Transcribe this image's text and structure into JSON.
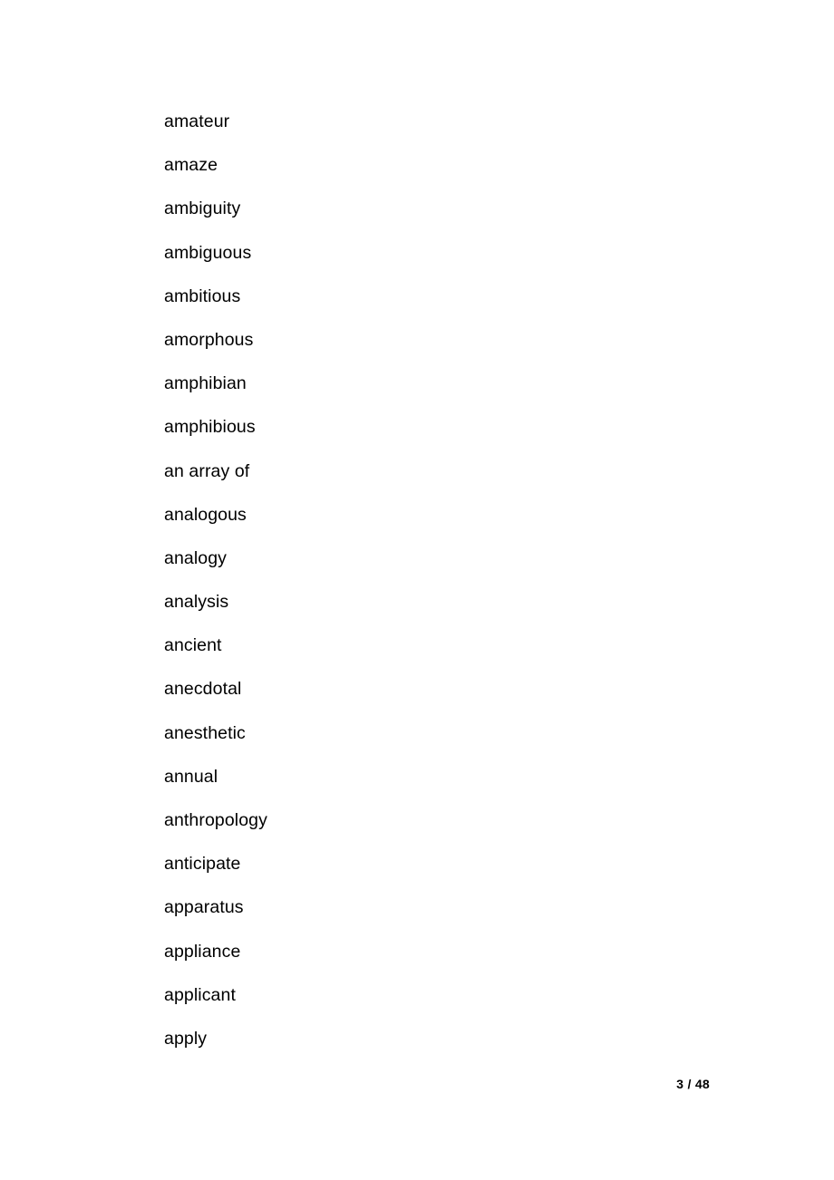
{
  "document": {
    "background_color": "#ffffff",
    "text_color": "#000000",
    "word_list": [
      {
        "term": "amateur"
      },
      {
        "term": "amaze"
      },
      {
        "term": "ambiguity"
      },
      {
        "term": "ambiguous"
      },
      {
        "term": "ambitious"
      },
      {
        "term": "amorphous"
      },
      {
        "term": "amphibian"
      },
      {
        "term": "amphibious"
      },
      {
        "term": "an array of"
      },
      {
        "term": "analogous"
      },
      {
        "term": "analogy"
      },
      {
        "term": "analysis"
      },
      {
        "term": "ancient"
      },
      {
        "term": "anecdotal"
      },
      {
        "term": "anesthetic"
      },
      {
        "term": "annual"
      },
      {
        "term": "anthropology"
      },
      {
        "term": "anticipate"
      },
      {
        "term": "apparatus"
      },
      {
        "term": "appliance"
      },
      {
        "term": "applicant"
      },
      {
        "term": "apply"
      }
    ],
    "footer": {
      "page_label": "3 / 48",
      "current_page": 3,
      "total_pages": 48
    }
  }
}
